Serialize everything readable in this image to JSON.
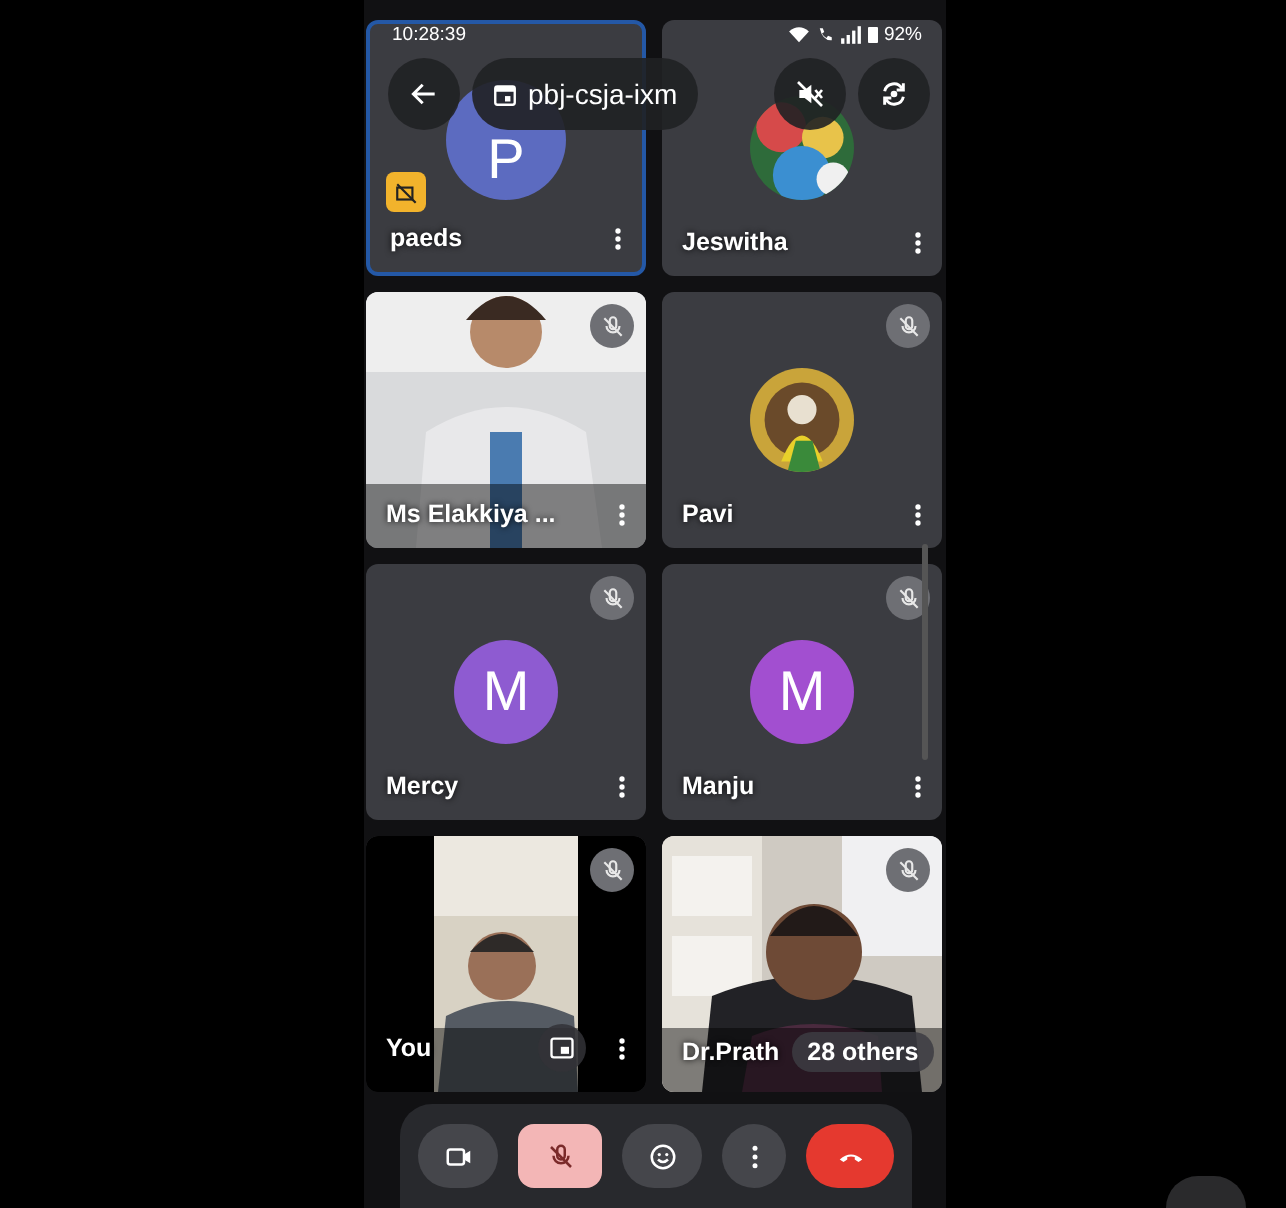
{
  "status_bar": {
    "time": "10:28:39",
    "battery": "92%"
  },
  "top_bar": {
    "meeting_code": "pbj-csja-ixm"
  },
  "tiles": [
    {
      "name": "paeds",
      "kind": "letter",
      "letter": "P",
      "color": "#5c6bc0",
      "muted": false,
      "highlighted": true,
      "camera_off_badge": true
    },
    {
      "name": "Jeswitha",
      "muted": false,
      "highlighted": false,
      "camera_off_badge": false
    },
    {
      "name": "Ms Elakkiya ...",
      "kind": "video",
      "muted": true,
      "highlighted": false,
      "camera_off_badge": false
    },
    {
      "name": "Pavi",
      "muted": true,
      "highlighted": false,
      "camera_off_badge": false
    },
    {
      "name": "Mercy",
      "kind": "letter",
      "letter": "M",
      "color": "#8e5bd1",
      "muted": true,
      "highlighted": false,
      "camera_off_badge": false
    },
    {
      "name": "Manju",
      "kind": "letter",
      "letter": "M",
      "color": "#a24fd0",
      "muted": true,
      "highlighted": false,
      "camera_off_badge": false
    },
    {
      "name": "You",
      "kind": "self_video",
      "muted": true,
      "highlighted": false,
      "camera_off_badge": false
    },
    {
      "name": "Dr.Prath",
      "kind": "video",
      "muted": true,
      "highlighted": false,
      "camera_off_badge": false,
      "others": "28 others"
    }
  ],
  "controls": [
    {
      "kind": "camera",
      "on": true
    },
    {
      "kind": "mic",
      "on": false
    },
    {
      "kind": "reactions",
      "on": true
    },
    {
      "kind": "more",
      "on": true
    },
    {
      "kind": "hangup",
      "on": true
    }
  ]
}
